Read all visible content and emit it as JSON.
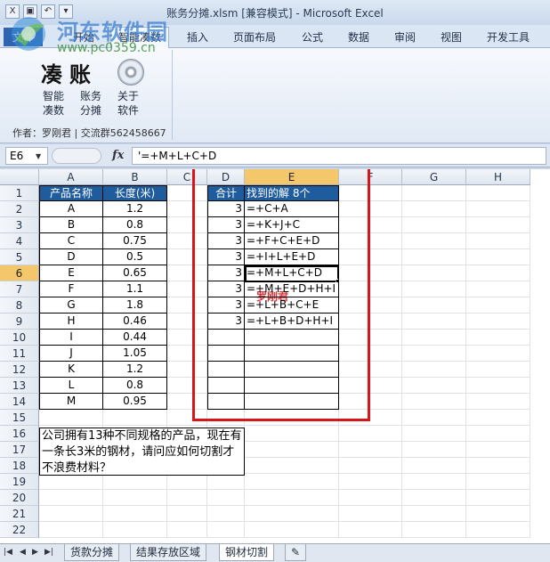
{
  "window": {
    "title": "账务分摊.xlsm  [兼容模式] - Microsoft Excel"
  },
  "quick_access": [
    "X",
    "▣",
    "↶",
    "▾"
  ],
  "watermark": {
    "name": "河东软件园",
    "url": "www.pc0359.cn"
  },
  "ribbon": {
    "tabs": [
      "文件",
      "开始",
      "智能凑数",
      "插入",
      "页面布局",
      "公式",
      "数据",
      "审阅",
      "视图",
      "开发工具"
    ],
    "active_tab": "智能凑数",
    "group_title": "凑账",
    "buttons": [
      {
        "line1": "智能",
        "line2": "凑数"
      },
      {
        "line1": "账务",
        "line2": "分摊"
      },
      {
        "line1": "关于",
        "line2": "软件"
      }
    ],
    "author": "作者：罗刚君 | 交流群562458667"
  },
  "formula_bar": {
    "name_box": "E6",
    "fx": "fx",
    "content": "'=+M+L+C+D"
  },
  "columns": [
    "A",
    "B",
    "C",
    "D",
    "E",
    "F",
    "G",
    "H"
  ],
  "selected_column": "E",
  "rows": [
    "1",
    "2",
    "3",
    "4",
    "5",
    "6",
    "7",
    "8",
    "9",
    "10",
    "11",
    "12",
    "13",
    "14",
    "15",
    "16",
    "17",
    "18",
    "19",
    "20",
    "21",
    "22"
  ],
  "selected_row": "6",
  "products": {
    "header": [
      "产品名称",
      "长度(米)"
    ],
    "rows": [
      [
        "A",
        "1.2"
      ],
      [
        "B",
        "0.8"
      ],
      [
        "C",
        "0.75"
      ],
      [
        "D",
        "0.5"
      ],
      [
        "E",
        "0.65"
      ],
      [
        "F",
        "1.1"
      ],
      [
        "G",
        "1.8"
      ],
      [
        "H",
        "0.46"
      ],
      [
        "I",
        "0.44"
      ],
      [
        "J",
        "1.05"
      ],
      [
        "K",
        "1.2"
      ],
      [
        "L",
        "0.8"
      ],
      [
        "M",
        "0.95"
      ]
    ]
  },
  "solutions": {
    "header": [
      "合计",
      "找到的解 8个"
    ],
    "rows": [
      [
        "3",
        "=+C+A"
      ],
      [
        "3",
        "=+K+J+C"
      ],
      [
        "3",
        "=+F+C+E+D"
      ],
      [
        "3",
        "=+I+L+E+D"
      ],
      [
        "3",
        "=+M+L+C+D"
      ],
      [
        "3",
        "=+M+E+D+H+I"
      ],
      [
        "3",
        "=+L+B+C+E"
      ],
      [
        "3",
        "=+L+B+D+H+I"
      ],
      [
        "",
        ""
      ],
      [
        "",
        ""
      ],
      [
        "",
        ""
      ],
      [
        "",
        ""
      ],
      [
        "",
        ""
      ]
    ]
  },
  "stamp": "罗刚君",
  "question": "公司拥有13种不同规格的产品，现在有一条长3米的钢材，请问应如何切割才不浪费材料？",
  "sheet_tabs": [
    "货款分摊",
    "结果存放区域",
    "钢材切割"
  ],
  "active_sheet": "钢材切割",
  "colors": {
    "header_fill": "#1f5c9e",
    "highlight_box": "#d9151b",
    "selection": "#f5c76b"
  }
}
